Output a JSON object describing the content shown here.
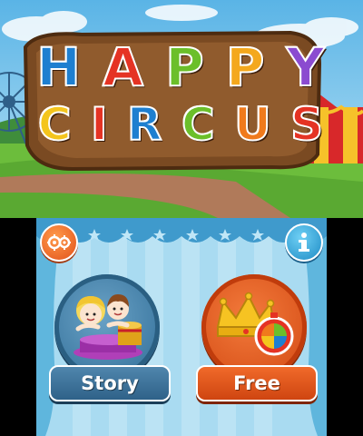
{
  "top_screen": {
    "title_line_1": [
      "H",
      "A",
      "P",
      "P",
      "Y"
    ],
    "title_line_2": [
      "C",
      "I",
      "R",
      "C",
      "U",
      "S"
    ],
    "title_colors_1": [
      "#1e7fd0",
      "#e53324",
      "#6bbf2a",
      "#f4a81d",
      "#8b4bd0"
    ],
    "title_colors_2": [
      "#f4c51d",
      "#e53324",
      "#1e7fd0",
      "#6bbf2a",
      "#f07a1c",
      "#e53324"
    ],
    "icons": [
      "ferris-wheel-icon",
      "circus-tent-icon"
    ]
  },
  "bottom_screen": {
    "buttons": {
      "settings_icon": "gears-icon",
      "info_icon": "info-icon",
      "story_label": "Story",
      "free_label": "Free"
    }
  }
}
